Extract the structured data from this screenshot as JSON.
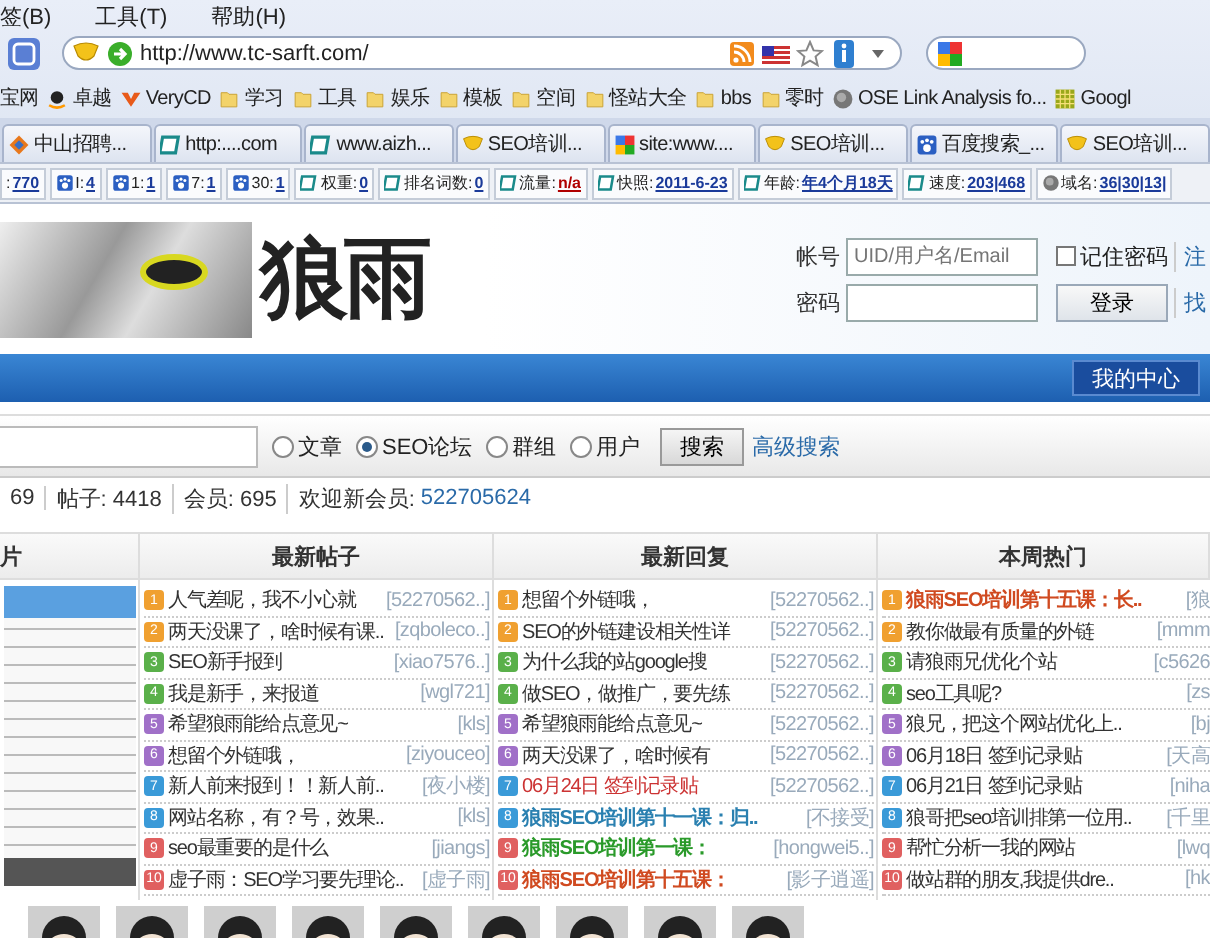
{
  "menu": [
    "签(B)",
    "工具(T)",
    "帮助(H)"
  ],
  "address_bar": {
    "url": "http://www.tc-sarft.com/"
  },
  "bookmarks": [
    {
      "label": "宝网",
      "kind": "none"
    },
    {
      "label": "卓越",
      "kind": "amazon"
    },
    {
      "label": "VeryCD",
      "kind": "verycd"
    },
    {
      "label": "学习",
      "kind": "folder"
    },
    {
      "label": "工具",
      "kind": "folder"
    },
    {
      "label": "娱乐",
      "kind": "folder"
    },
    {
      "label": "模板",
      "kind": "folder"
    },
    {
      "label": "空间",
      "kind": "folder"
    },
    {
      "label": "怪站大全",
      "kind": "folder"
    },
    {
      "label": "bbs",
      "kind": "folder"
    },
    {
      "label": "零时",
      "kind": "folder"
    },
    {
      "label": "OSE Link Analysis fo...",
      "kind": "globe"
    },
    {
      "label": "Googl",
      "kind": "grid"
    }
  ],
  "tabs": [
    {
      "label": "中山招聘...",
      "kind": "diamond"
    },
    {
      "label": "http:....com",
      "kind": "page"
    },
    {
      "label": "www.aizh...",
      "kind": "page"
    },
    {
      "label": "SEO培训...",
      "kind": "shield"
    },
    {
      "label": "site:www....",
      "kind": "google"
    },
    {
      "label": "SEO培训...",
      "kind": "shield"
    },
    {
      "label": "百度搜索_...",
      "kind": "paw"
    },
    {
      "label": "SEO培训...",
      "kind": "shield"
    }
  ],
  "seo_toolbar": [
    {
      "label": ":",
      "value": "770",
      "kind": "none",
      "color": "#1a3a9a"
    },
    {
      "label": "I:",
      "value": "4",
      "kind": "paw",
      "color": "#1a3a9a"
    },
    {
      "label": "1:",
      "value": "1",
      "kind": "paw",
      "color": "#1a3a9a"
    },
    {
      "label": "7:",
      "value": "1",
      "kind": "paw",
      "color": "#1a3a9a"
    },
    {
      "label": "30:",
      "value": "1",
      "kind": "paw",
      "color": "#1a3a9a"
    },
    {
      "label": "权重:",
      "value": "0",
      "kind": "page",
      "color": "#1a3a9a"
    },
    {
      "label": "排名词数:",
      "value": "0",
      "kind": "page",
      "color": "#1a3a9a"
    },
    {
      "label": "流量:",
      "value": "n/a",
      "kind": "page",
      "color": "#b00000"
    },
    {
      "label": "快照:",
      "value": "2011-6-23",
      "kind": "page",
      "color": "#1a3a9a"
    },
    {
      "label": "年龄:",
      "value": "年4个月18天",
      "kind": "page",
      "color": "#1a3a9a"
    },
    {
      "label": "速度:",
      "value": "203|468",
      "kind": "page",
      "color": "#1a3a9a"
    },
    {
      "label": "域名:",
      "value": "36|30|13|",
      "kind": "globe",
      "color": "#1a3a9a"
    }
  ],
  "header": {
    "logo_text": "狼雨",
    "login": {
      "account_label": "帐号",
      "account_placeholder": "UID/用户名/Email",
      "remember": {
        "label": "记住密码",
        "checked": false
      },
      "password_label": "密码",
      "login_button": "登录",
      "links": [
        "注",
        "找"
      ]
    }
  },
  "nav": {
    "my_center": "我的中心"
  },
  "search": {
    "scopes": [
      {
        "label": "文章",
        "selected": false
      },
      {
        "label": "SEO论坛",
        "selected": true
      },
      {
        "label": "群组",
        "selected": false
      },
      {
        "label": "用户",
        "selected": false
      }
    ],
    "button": "搜索",
    "advanced": "高级搜索"
  },
  "stats": {
    "items": [
      "69",
      "帖子: 4418",
      "会员: 695"
    ],
    "new_member_label": "欢迎新会员:",
    "new_member": "522705624"
  },
  "board": {
    "columns": [
      {
        "title": "片",
        "kind": "slideshow"
      },
      {
        "title": "最新帖子",
        "kind": "list",
        "items": [
          {
            "rank": "1",
            "title": "人气差呢，我不小心就",
            "author": "[52270562..]",
            "color": "#333333",
            "bold": false
          },
          {
            "rank": "2",
            "title": "两天没课了，啥时候有课..",
            "author": "[zqboleco..]",
            "color": "#333333",
            "bold": false
          },
          {
            "rank": "3",
            "title": "SEO新手报到",
            "author": "[xiao7576..]",
            "color": "#333333",
            "bold": false
          },
          {
            "rank": "4",
            "title": "我是新手，来报道",
            "author": "[wgl721]",
            "color": "#333333",
            "bold": false
          },
          {
            "rank": "5",
            "title": "希望狼雨能给点意见~",
            "author": "[kls]",
            "color": "#333333",
            "bold": false
          },
          {
            "rank": "6",
            "title": "想留个外链哦，",
            "author": "[ziyouceo]",
            "color": "#333333",
            "bold": false
          },
          {
            "rank": "7",
            "title": "新人前来报到！！新人前..",
            "author": "[夜小楼]",
            "color": "#333333",
            "bold": false
          },
          {
            "rank": "8",
            "title": "网站名称，有？号，效果..",
            "author": "[kls]",
            "color": "#333333",
            "bold": false
          },
          {
            "rank": "9",
            "title": "seo最重要的是什么",
            "author": "[jiangs]",
            "color": "#333333",
            "bold": false
          },
          {
            "rank": "10",
            "title": "虚子雨：SEO学习要先理论..",
            "author": "[虚子雨]",
            "color": "#333333",
            "bold": false
          }
        ]
      },
      {
        "title": "最新回复",
        "kind": "list",
        "items": [
          {
            "rank": "1",
            "title": "想留个外链哦，",
            "author": "[52270562..]",
            "color": "#333333",
            "bold": false
          },
          {
            "rank": "2",
            "title": "SEO的外链建设相关性详",
            "author": "[52270562..]",
            "color": "#333333",
            "bold": false
          },
          {
            "rank": "3",
            "title": "为什么我的站google搜",
            "author": "[52270562..]",
            "color": "#333333",
            "bold": false
          },
          {
            "rank": "4",
            "title": "做SEO，做推广，要先练",
            "author": "[52270562..]",
            "color": "#333333",
            "bold": false
          },
          {
            "rank": "5",
            "title": "希望狼雨能给点意见~",
            "author": "[52270562..]",
            "color": "#333333",
            "bold": false
          },
          {
            "rank": "6",
            "title": "两天没课了，啥时候有",
            "author": "[52270562..]",
            "color": "#333333",
            "bold": false
          },
          {
            "rank": "7",
            "title": "06月24日 签到记录贴",
            "author": "[52270562..]",
            "color": "#cc3333",
            "bold": false
          },
          {
            "rank": "8",
            "title": "狼雨SEO培训第十一课：归..",
            "author": "[不接受]",
            "color": "#2a80b0",
            "bold": true
          },
          {
            "rank": "9",
            "title": "狼雨SEO培训第一课：",
            "author": "[hongwei5..]",
            "color": "#2a9a2a",
            "bold": true
          },
          {
            "rank": "10",
            "title": "狼雨SEO培训第十五课：",
            "author": "[影子逍遥]",
            "color": "#d04a20",
            "bold": true
          }
        ]
      },
      {
        "title": "本周热门",
        "kind": "list",
        "items": [
          {
            "rank": "1",
            "title": "狼雨SEO培训第十五课：长..",
            "author": "[狼",
            "color": "#d04a20",
            "bold": true
          },
          {
            "rank": "2",
            "title": "教你做最有质量的外链",
            "author": "[mmm",
            "color": "#333333",
            "bold": false
          },
          {
            "rank": "3",
            "title": "请狼雨兄优化个站",
            "author": "[c5626",
            "color": "#333333",
            "bold": false
          },
          {
            "rank": "4",
            "title": "seo工具呢?",
            "author": "[zs",
            "color": "#333333",
            "bold": false
          },
          {
            "rank": "5",
            "title": "狼兄，把这个网站优化上..",
            "author": "[bj",
            "color": "#333333",
            "bold": false
          },
          {
            "rank": "6",
            "title": "06月18日 签到记录贴",
            "author": "[天高",
            "color": "#333333",
            "bold": false
          },
          {
            "rank": "7",
            "title": "06月21日 签到记录贴",
            "author": "[niha",
            "color": "#333333",
            "bold": false
          },
          {
            "rank": "8",
            "title": "狼哥把seo培训排第一位用..",
            "author": "[千里",
            "color": "#333333",
            "bold": false
          },
          {
            "rank": "9",
            "title": "帮忙分析一我的网站",
            "author": "[lwq",
            "color": "#333333",
            "bold": false
          },
          {
            "rank": "10",
            "title": "做站群的朋友,我提供dre..",
            "author": "[hk",
            "color": "#333333",
            "bold": false
          }
        ]
      }
    ]
  }
}
